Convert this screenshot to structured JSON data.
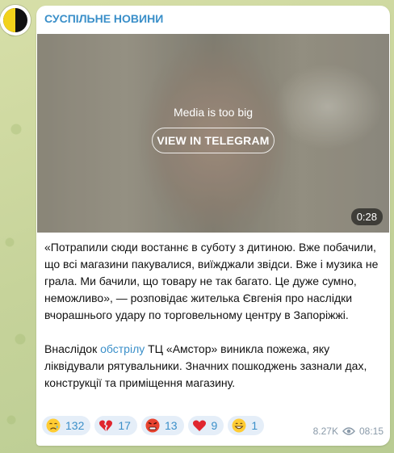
{
  "channel": {
    "name": "СУСПІЛЬНЕ НОВИНИ"
  },
  "media": {
    "notice": "Media is too big",
    "button_label": "VIEW IN TELEGRAM",
    "duration": "0:28"
  },
  "message": {
    "paragraph1": "«Потрапили сюди востаннє в суботу з дитиною. Вже побачили, що всі магазини пакувалися, виїжджали звідси. Вже і музика не грала. Ми бачили, що товару не так багато. Це дуже сумно, неможливо», — розповідає жителька Євгенія про наслідки вчорашнього удару по торговельному центру в Запоріжжі.",
    "paragraph2_before": "Внаслідок ",
    "paragraph2_link": "обстрілу",
    "paragraph2_after": " ТЦ «Амстор» виникла пожежа, яку ліквідували рятувальники. Значних пошкоджень зазнали дах, конструкції та приміщення магазину."
  },
  "reactions": [
    {
      "icon": "crying-face-icon",
      "count": "132"
    },
    {
      "icon": "broken-heart-icon",
      "count": "17"
    },
    {
      "icon": "angry-face-icon",
      "count": "13"
    },
    {
      "icon": "red-heart-icon",
      "count": "9"
    },
    {
      "icon": "grinning-face-icon",
      "count": "1"
    }
  ],
  "meta": {
    "views": "8.27K",
    "time": "08:15",
    "views_icon": "eye-icon"
  },
  "colors": {
    "accent": "#3a8fc9",
    "reaction_bg": "#e5eef8",
    "bubble": "#ffffff"
  }
}
